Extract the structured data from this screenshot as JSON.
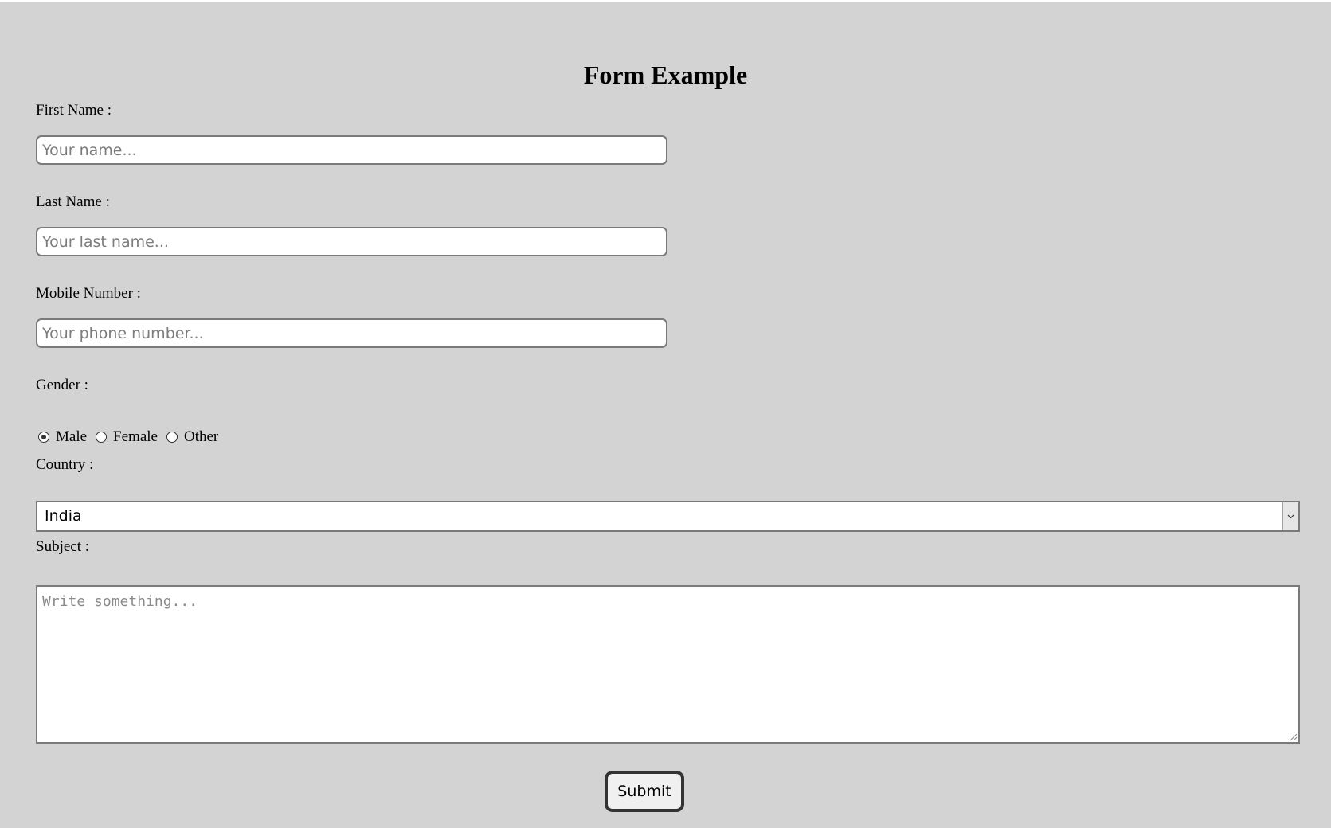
{
  "form": {
    "title": "Form Example",
    "first_name": {
      "label": "First Name :",
      "placeholder": "Your name...",
      "value": ""
    },
    "last_name": {
      "label": "Last Name :",
      "placeholder": "Your last name...",
      "value": ""
    },
    "mobile": {
      "label": "Mobile Number :",
      "placeholder": "Your phone number...",
      "value": ""
    },
    "gender": {
      "label": "Gender :",
      "options": [
        {
          "label": "Male",
          "checked": true
        },
        {
          "label": "Female",
          "checked": false
        },
        {
          "label": "Other",
          "checked": false
        }
      ]
    },
    "country": {
      "label": "Country :",
      "selected": "India",
      "icon": "chevron-down-icon"
    },
    "subject": {
      "label": "Subject :",
      "placeholder": "Write something...",
      "value": ""
    },
    "submit_label": "Submit"
  },
  "colors": {
    "page_background": "#d3d3d3",
    "field_background": "#ffffff",
    "field_border": "#7a7a7a",
    "placeholder_text": "#7c7c7c",
    "button_border": "#333333",
    "button_background": "#f0f0f0"
  }
}
